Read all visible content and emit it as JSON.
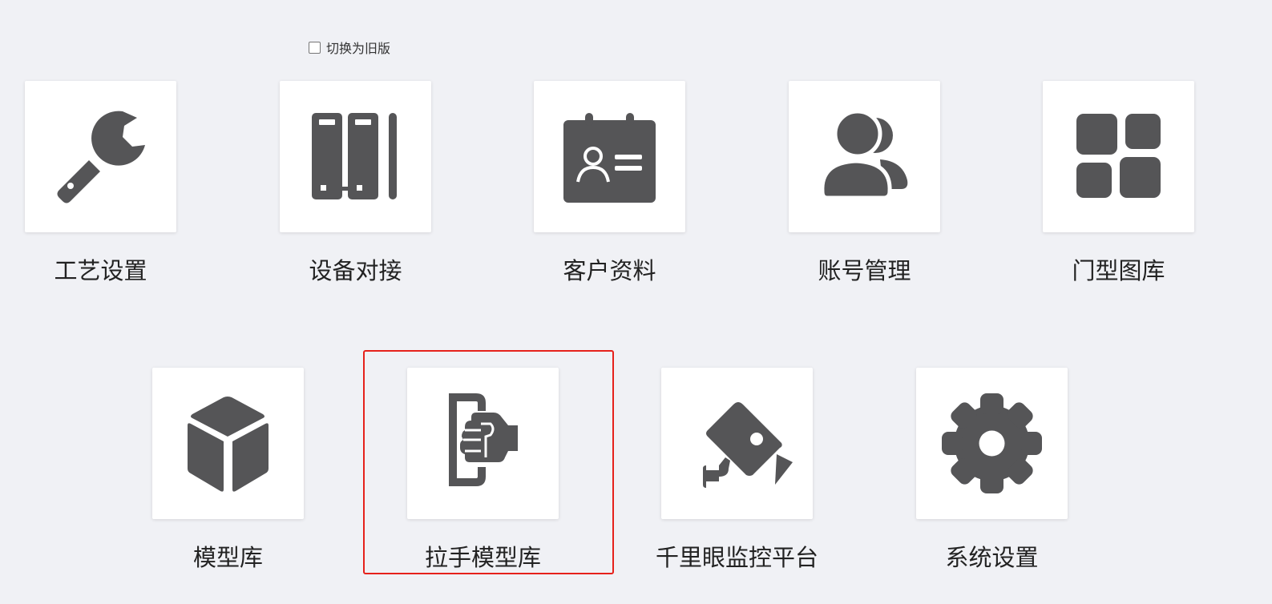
{
  "toggle": {
    "label": "切换为旧版",
    "checked": false
  },
  "colors": {
    "background": "#f0f1f5",
    "card": "#ffffff",
    "icon": "#555557",
    "highlight_border": "#e6211b"
  },
  "tiles": [
    {
      "label": "工艺设置",
      "icon": "wrench-icon"
    },
    {
      "label": "设备对接",
      "icon": "binders-icon"
    },
    {
      "label": "客户资料",
      "icon": "contact-card-icon"
    },
    {
      "label": "账号管理",
      "icon": "users-icon"
    },
    {
      "label": "门型图库",
      "icon": "grid-icon"
    },
    {
      "label": "模型库",
      "icon": "cube-icon"
    },
    {
      "label": "拉手模型库",
      "icon": "handle-grip-icon"
    },
    {
      "label": "千里眼监控平台",
      "icon": "security-camera-icon"
    },
    {
      "label": "系统设置",
      "icon": "gear-icon"
    }
  ]
}
